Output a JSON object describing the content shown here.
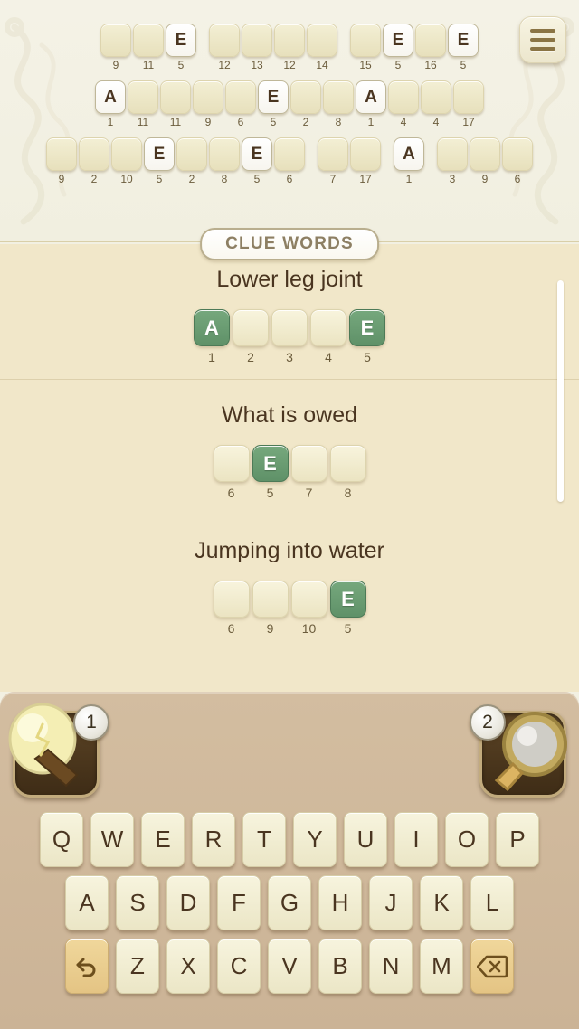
{
  "app": {
    "title": "Word Puzzle - Cryptogram",
    "accent_green": "#5f9168",
    "tile_cream": "#f1ead0",
    "panel_cream": "#f2f0e2",
    "panel_beige": "#f1e7c9",
    "keyboard_tan": "#cbb396"
  },
  "header": {
    "menu_icon": "hamburger-menu-icon"
  },
  "board": {
    "rows": [
      {
        "groups": [
          {
            "tiles": [
              {
                "letter": "",
                "num": "9"
              },
              {
                "letter": "",
                "num": "11"
              },
              {
                "letter": "E",
                "num": "5"
              }
            ]
          },
          {
            "tiles": [
              {
                "letter": "",
                "num": "12"
              },
              {
                "letter": "",
                "num": "13"
              },
              {
                "letter": "",
                "num": "12"
              },
              {
                "letter": "",
                "num": "14"
              }
            ]
          },
          {
            "tiles": [
              {
                "letter": "",
                "num": "15"
              },
              {
                "letter": "E",
                "num": "5"
              },
              {
                "letter": "",
                "num": "16"
              },
              {
                "letter": "E",
                "num": "5"
              }
            ]
          }
        ]
      },
      {
        "groups": [
          {
            "tiles": [
              {
                "letter": "A",
                "num": "1"
              },
              {
                "letter": "",
                "num": "11"
              },
              {
                "letter": "",
                "num": "11"
              },
              {
                "letter": "",
                "num": "9"
              },
              {
                "letter": "",
                "num": "6"
              },
              {
                "letter": "E",
                "num": "5"
              },
              {
                "letter": "",
                "num": "2"
              },
              {
                "letter": "",
                "num": "8"
              },
              {
                "letter": "A",
                "num": "1"
              },
              {
                "letter": "",
                "num": "4"
              },
              {
                "letter": "",
                "num": "4"
              },
              {
                "letter": "",
                "num": "17"
              }
            ]
          }
        ]
      },
      {
        "groups": [
          {
            "tiles": [
              {
                "letter": "",
                "num": "9"
              },
              {
                "letter": "",
                "num": "2"
              },
              {
                "letter": "",
                "num": "10"
              },
              {
                "letter": "E",
                "num": "5"
              },
              {
                "letter": "",
                "num": "2"
              },
              {
                "letter": "",
                "num": "8"
              },
              {
                "letter": "E",
                "num": "5"
              },
              {
                "letter": "",
                "num": "6"
              }
            ]
          },
          {
            "tiles": [
              {
                "letter": "",
                "num": "7"
              },
              {
                "letter": "",
                "num": "17"
              }
            ]
          },
          {
            "tiles": [
              {
                "letter": "A",
                "num": "1"
              }
            ]
          },
          {
            "tiles": [
              {
                "letter": "",
                "num": "3"
              },
              {
                "letter": "",
                "num": "9"
              },
              {
                "letter": "",
                "num": "6"
              }
            ]
          }
        ]
      }
    ]
  },
  "clue_section": {
    "header_label": "CLUE WORDS",
    "clues": [
      {
        "text": "Lower leg joint",
        "tiles": [
          {
            "letter": "A",
            "num": "1",
            "solved": true
          },
          {
            "letter": "",
            "num": "2",
            "solved": false
          },
          {
            "letter": "",
            "num": "3",
            "solved": false
          },
          {
            "letter": "",
            "num": "4",
            "solved": false
          },
          {
            "letter": "E",
            "num": "5",
            "solved": true
          }
        ]
      },
      {
        "text": "What is owed",
        "tiles": [
          {
            "letter": "",
            "num": "6",
            "solved": false
          },
          {
            "letter": "E",
            "num": "5",
            "solved": true
          },
          {
            "letter": "",
            "num": "7",
            "solved": false
          },
          {
            "letter": "",
            "num": "8",
            "solved": false
          }
        ]
      },
      {
        "text": "Jumping into water",
        "tiles": [
          {
            "letter": "",
            "num": "6",
            "solved": false
          },
          {
            "letter": "",
            "num": "9",
            "solved": false
          },
          {
            "letter": "",
            "num": "10",
            "solved": false
          },
          {
            "letter": "E",
            "num": "5",
            "solved": true
          }
        ]
      }
    ]
  },
  "hints": {
    "lightbulb": {
      "icon": "lightbulb-icon",
      "count": "1"
    },
    "magnifier": {
      "icon": "magnifying-glass-icon",
      "count": "2"
    }
  },
  "keyboard": {
    "row1": [
      "Q",
      "W",
      "E",
      "R",
      "T",
      "Y",
      "U",
      "I",
      "O",
      "P"
    ],
    "row2": [
      "A",
      "S",
      "D",
      "F",
      "G",
      "H",
      "J",
      "K",
      "L"
    ],
    "row3": [
      "Z",
      "X",
      "C",
      "V",
      "B",
      "N",
      "M"
    ],
    "undo": {
      "icon": "undo-arrow-icon"
    },
    "backspace": {
      "icon": "backspace-icon"
    }
  }
}
